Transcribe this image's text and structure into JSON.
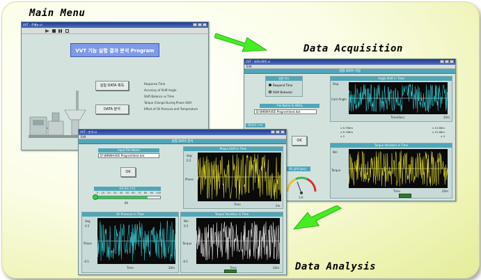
{
  "captions": {
    "main_menu": "Main Menu",
    "data_acquisition": "Data Acquisition",
    "data_analysis": "Data Analysis"
  },
  "main_menu_window": {
    "title": "VVT - 주메뉴.vi",
    "banner": "VVT 기능 실험 결과 분석 Program",
    "acquire_button": "실험 DATA 획득",
    "analysis_button": "DATA 분석",
    "features": [
      "Response Time",
      "Accuracy of Shift Angle",
      "Shift Balance vs Time",
      "Torque Change During Phase Shift",
      "Effect of Oil Pressure and Temperature"
    ]
  },
  "acquisition_window": {
    "title": "VVT - 데이터획득.vi",
    "menu": "Edit",
    "header": "실험 DATA 저장",
    "mode_panel_title": "실험 모드",
    "mode_options": [
      "Respond Time",
      "Shift Behavior"
    ],
    "file_label": "File Name to Write",
    "file_value": "D:\\WKWH\\VEE Program\\test.dat",
    "ok_button": "OK",
    "oil_temp_label": "Oil온도 (℃)",
    "oil_temp_scale": [
      "100",
      "90",
      "80",
      "70",
      "60",
      "50",
      "40",
      "30",
      "20",
      "10",
      "0"
    ],
    "oil_temp_value": "80",
    "oil_pressure_label": "Oil 압력 (bar)",
    "oil_pressure_value": "3.0",
    "angle_plot_title": "Angle Shift in Time",
    "angle_y_top": "Deg",
    "angle_y_mid": "Cam Angle",
    "angle_x_label": "Time(Sec)",
    "angle_x_end": "20m",
    "stats": [
      "x 8.768m",
      "x 43.68m",
      "x 8.768m",
      "x 43.68m",
      "x 0",
      "x 0"
    ],
    "torque_plot_title": "Torque Variation in Time",
    "torque_y_top": "Nm",
    "torque_y_mid": "Torque",
    "torque_x_label": "Time",
    "torque_x_end": "20m"
  },
  "analysis_window": {
    "title": "VVT - 분석.vi",
    "menu": "Edit",
    "header": "실험 DATA 분석",
    "input_file_label": "Input File Name",
    "input_file_value": "D:\\WKWH\\VEE Program\\test.dat",
    "ok_button": "OK",
    "oil_temp_label": "Oil 온도 (℃)",
    "oil_temp_scale": [
      "0",
      "10",
      "20",
      "30",
      "40",
      "50",
      "60",
      "70",
      "80",
      "90",
      "100"
    ],
    "oil_temp_value": "80",
    "phase_plot_title": "Phase Shift in Time",
    "phase_y_top": "deg",
    "phase_y_tick": "0.2",
    "phase_y_mid": "Phase",
    "phase_x_label": "Time",
    "phase_x_end": "2m",
    "oil_pressure_plot_title": "Oil Pressure in Time",
    "oilp_y_top": "deg",
    "oilp_y_tick": "0.5",
    "oilp_y_mid": "Phase",
    "oilp_y_bottom": "-0.5",
    "oilp_x_label": "Time",
    "oilp_x_end": "20m",
    "torque_plot_title": "Torque Variation in Time",
    "torque_y_top": "Nm",
    "torque_y_tick": "0.5",
    "torque_y_mid": "Torque",
    "torque_y_bottom": "-0.5",
    "torque_x_label": "Time",
    "torque_x_end": "20m"
  },
  "colors": {
    "arrow": "#44ee22",
    "trace_cyan": "#34c6cf",
    "trace_yellow": "#d9d22c",
    "trace_white": "#e6e6e6",
    "header_teal": "#4ea6b8"
  }
}
